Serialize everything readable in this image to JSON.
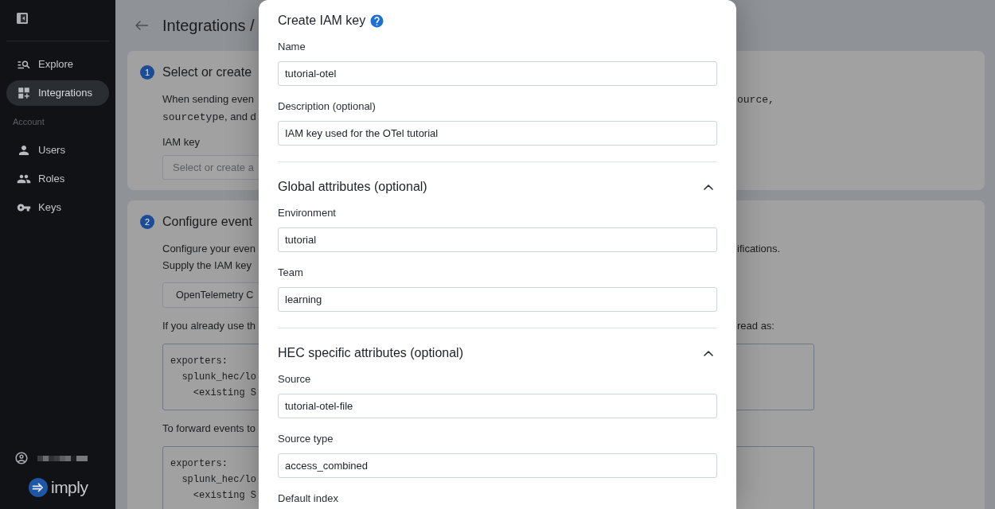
{
  "sidebar": {
    "nav": [
      {
        "label": "Explore",
        "selected": false
      },
      {
        "label": "Integrations",
        "selected": true
      }
    ],
    "account_heading": "Account",
    "account_nav": [
      {
        "label": "Users",
        "selected": false
      },
      {
        "label": "Roles",
        "selected": false
      },
      {
        "label": "Keys",
        "selected": false
      }
    ],
    "logo": "imply"
  },
  "page": {
    "title": "Integrations /",
    "steps": [
      {
        "number": "1",
        "title": "Select or create",
        "content": [
          {
            "kind": "line",
            "left": [
              {
                "kind": "text",
                "text": "When sending even"
              }
            ],
            "right": [
              {
                "kind": "code",
                "text": "ource,"
              }
            ]
          },
          {
            "kind": "line",
            "left": [
              {
                "kind": "code",
                "text": "sourcetype"
              },
              {
                "kind": "text",
                "text": ", and d"
              }
            ]
          },
          {
            "kind": "select",
            "label": "IAM key",
            "placeholder": "Select or create a"
          }
        ]
      },
      {
        "number": "2",
        "title": "Configure event",
        "content": [
          {
            "kind": "line",
            "left": [
              {
                "kind": "text",
                "text": "Configure your even"
              }
            ],
            "right": [
              {
                "kind": "text",
                "text": "ifications."
              }
            ]
          },
          {
            "kind": "line",
            "left": [
              {
                "kind": "text",
                "text": "Supply the IAM key"
              }
            ]
          },
          {
            "kind": "button",
            "label": "OpenTelemetry C"
          },
          {
            "kind": "line",
            "left": [
              {
                "kind": "text",
                "text": "If you already use th"
              }
            ],
            "right": [
              {
                "kind": "text",
                "text": "read as:"
              }
            ]
          },
          {
            "kind": "code",
            "lines": [
              "exporters:",
              "  splunk_hec/lo",
              "    <existing S"
            ]
          },
          {
            "kind": "line",
            "left": [
              {
                "kind": "text",
                "text": "To forward events to"
              }
            ]
          },
          {
            "kind": "code",
            "lines": [
              "exporters:",
              "  splunk_hec/lo",
              "    <existing S"
            ]
          }
        ]
      }
    ]
  },
  "dialog": {
    "title": "Create IAM key",
    "fields": [
      {
        "label": "Name",
        "value": "tutorial-otel"
      },
      {
        "label": "Description (optional)",
        "value": "IAM key used for the OTel tutorial"
      }
    ],
    "sections": [
      {
        "title": "Global attributes (optional)",
        "expanded": true,
        "fields": [
          {
            "label": "Environment",
            "value": "tutorial"
          },
          {
            "label": "Team",
            "value": "learning"
          }
        ]
      },
      {
        "title": "HEC specific attributes (optional)",
        "expanded": true,
        "fields": [
          {
            "label": "Source",
            "value": "tutorial-otel-file"
          },
          {
            "label": "Source type",
            "value": "access_combined"
          },
          {
            "label": "Default index"
          }
        ]
      }
    ]
  }
}
